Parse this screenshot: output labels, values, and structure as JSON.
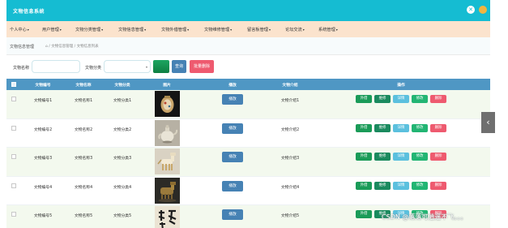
{
  "app": {
    "title": "文物信息系统"
  },
  "topbar": {
    "close_glyph": "✕",
    "colors": {
      "bar": "#15bcd2",
      "avatar": "#f1b541"
    }
  },
  "menu": [
    {
      "label": "个人中心"
    },
    {
      "label": "用户管理"
    },
    {
      "label": "文物分类管理"
    },
    {
      "label": "文物信息管理"
    },
    {
      "label": "文物外借管理"
    },
    {
      "label": "文物维修管理"
    },
    {
      "label": "留言板管理"
    },
    {
      "label": "论坛交流"
    },
    {
      "label": "系统管理"
    }
  ],
  "breadcrumb": {
    "title": "文物信息管理",
    "path": "⌂ / 文物信息管理 / 文物信息列表"
  },
  "search": {
    "name_label": "文物名称",
    "name_value": "",
    "category_label": "文物分类",
    "category_value": "",
    "query_label": "查询",
    "batch_delete_label": "批量删除"
  },
  "table": {
    "headers": [
      "文物编号",
      "文物名称",
      "文物分类",
      "图片",
      "播放",
      "文物介绍",
      "操作"
    ],
    "play_label": "播放",
    "actions": [
      "外借",
      "维修",
      "详情",
      "修改",
      "删除"
    ],
    "rows": [
      {
        "code": "文物编号1",
        "name": "文物名称1",
        "category": "文物分类1",
        "intro": "文物介绍1",
        "image_icon": "jar-icon"
      },
      {
        "code": "文物编号2",
        "name": "文物名称2",
        "category": "文物分类2",
        "intro": "文物介绍2",
        "image_icon": "teapot-icon"
      },
      {
        "code": "文物编号3",
        "name": "文物名称3",
        "category": "文物分类3",
        "intro": "文物介绍3",
        "image_icon": "horse-icon"
      },
      {
        "code": "文物编号4",
        "name": "文物名称4",
        "category": "文物分类4",
        "intro": "文物介绍4",
        "image_icon": "bronze-icon"
      },
      {
        "code": "文物编号5",
        "name": "文物名称5",
        "category": "文物分类5",
        "intro": "文物介绍5",
        "image_icon": "calligraphy-icon"
      }
    ]
  },
  "side_tab": {
    "glyph": "‹"
  },
  "watermark": "CSDN @落落可逍遥不飞。。。"
}
